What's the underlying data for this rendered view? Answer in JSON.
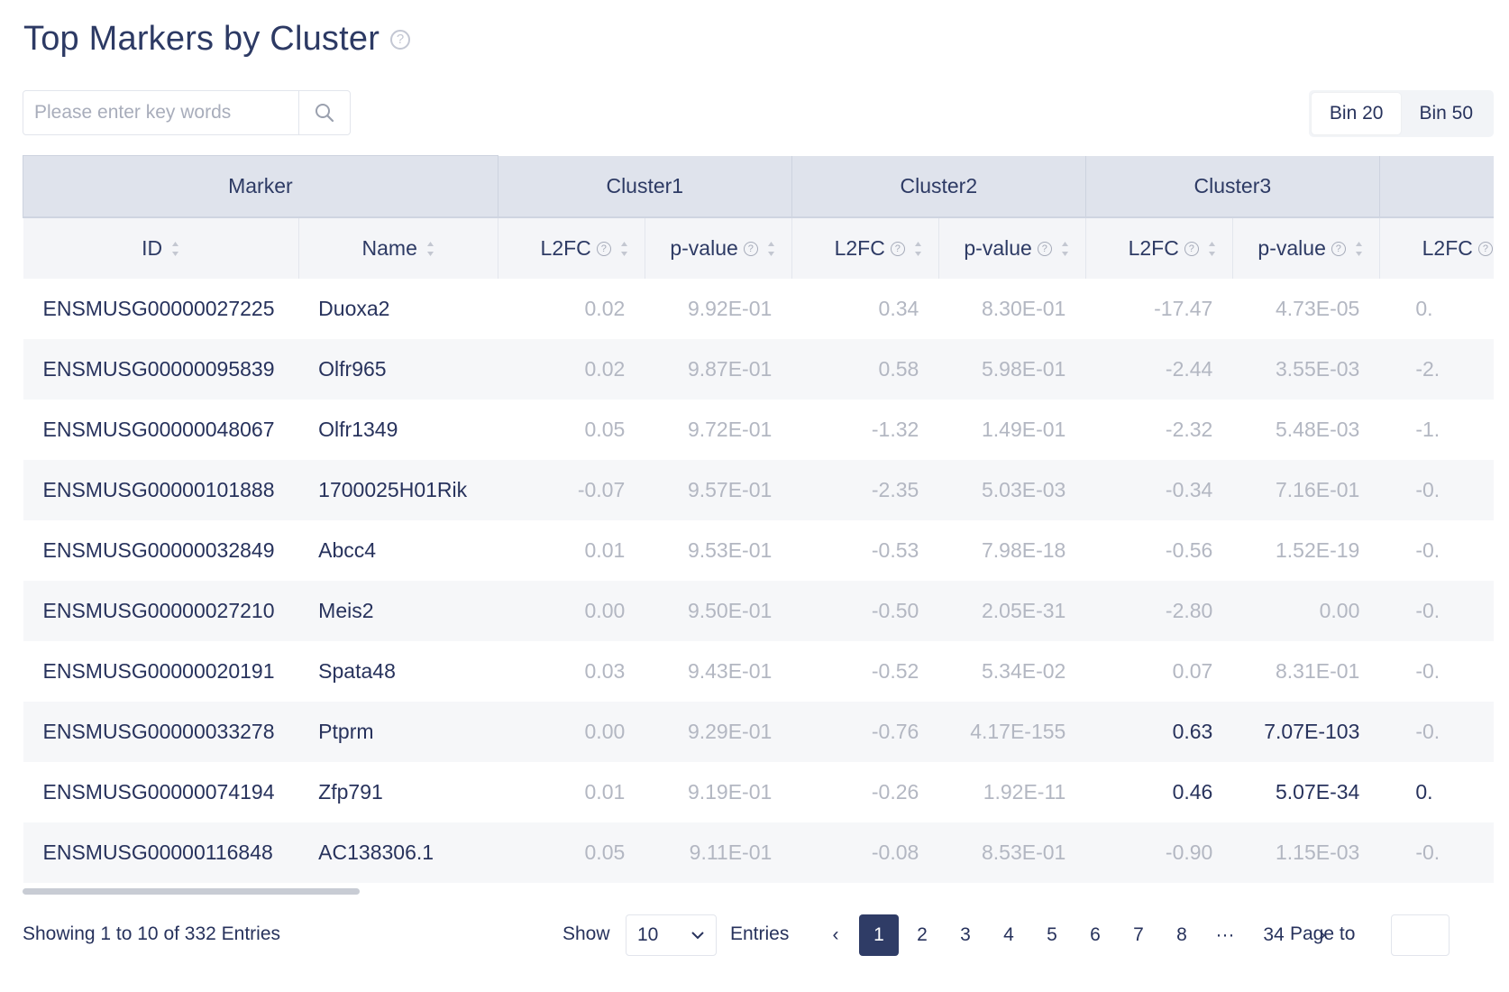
{
  "header": {
    "title": "Top Markers by Cluster",
    "help_glyph": "?"
  },
  "search": {
    "placeholder": "Please enter key words"
  },
  "bins": [
    "Bin 20",
    "Bin 50"
  ],
  "table": {
    "group_headers": {
      "marker": "Marker",
      "clusters": [
        "Cluster1",
        "Cluster2",
        "Cluster3",
        ""
      ]
    },
    "sub_headers": {
      "id": "ID",
      "name": "Name",
      "l2fc": "L2FC",
      "pvalue": "p-value"
    },
    "rows": [
      {
        "id": "ENSMUSG00000027225",
        "name": "Duoxa2",
        "c1_l2fc": "0.02",
        "c1_p": "9.92E-01",
        "c2_l2fc": "0.34",
        "c2_p": "8.30E-01",
        "c3_l2fc": "-17.47",
        "c3_p": "4.73E-05",
        "c4_l2fc": "0."
      },
      {
        "id": "ENSMUSG00000095839",
        "name": "Olfr965",
        "c1_l2fc": "0.02",
        "c1_p": "9.87E-01",
        "c2_l2fc": "0.58",
        "c2_p": "5.98E-01",
        "c3_l2fc": "-2.44",
        "c3_p": "3.55E-03",
        "c4_l2fc": "-2."
      },
      {
        "id": "ENSMUSG00000048067",
        "name": "Olfr1349",
        "c1_l2fc": "0.05",
        "c1_p": "9.72E-01",
        "c2_l2fc": "-1.32",
        "c2_p": "1.49E-01",
        "c3_l2fc": "-2.32",
        "c3_p": "5.48E-03",
        "c4_l2fc": "-1."
      },
      {
        "id": "ENSMUSG00000101888",
        "name": "1700025H01Rik",
        "c1_l2fc": "-0.07",
        "c1_p": "9.57E-01",
        "c2_l2fc": "-2.35",
        "c2_p": "5.03E-03",
        "c3_l2fc": "-0.34",
        "c3_p": "7.16E-01",
        "c4_l2fc": "-0."
      },
      {
        "id": "ENSMUSG00000032849",
        "name": "Abcc4",
        "c1_l2fc": "0.01",
        "c1_p": "9.53E-01",
        "c2_l2fc": "-0.53",
        "c2_p": "7.98E-18",
        "c3_l2fc": "-0.56",
        "c3_p": "1.52E-19",
        "c4_l2fc": "-0."
      },
      {
        "id": "ENSMUSG00000027210",
        "name": "Meis2",
        "c1_l2fc": "0.00",
        "c1_p": "9.50E-01",
        "c2_l2fc": "-0.50",
        "c2_p": "2.05E-31",
        "c3_l2fc": "-2.80",
        "c3_p": "0.00",
        "c4_l2fc": "-0."
      },
      {
        "id": "ENSMUSG00000020191",
        "name": "Spata48",
        "c1_l2fc": "0.03",
        "c1_p": "9.43E-01",
        "c2_l2fc": "-0.52",
        "c2_p": "5.34E-02",
        "c3_l2fc": "0.07",
        "c3_p": "8.31E-01",
        "c4_l2fc": "-0."
      },
      {
        "id": "ENSMUSG00000033278",
        "name": "Ptprm",
        "c1_l2fc": "0.00",
        "c1_p": "9.29E-01",
        "c2_l2fc": "-0.76",
        "c2_p": "4.17E-155",
        "c3_l2fc": "0.63",
        "c3_p": "7.07E-103",
        "c4_l2fc": "-0.",
        "c3_highlight": true
      },
      {
        "id": "ENSMUSG00000074194",
        "name": "Zfp791",
        "c1_l2fc": "0.01",
        "c1_p": "9.19E-01",
        "c2_l2fc": "-0.26",
        "c2_p": "1.92E-11",
        "c3_l2fc": "0.46",
        "c3_p": "5.07E-34",
        "c4_l2fc": "0.",
        "c3_highlight": true,
        "c4_highlight": true
      },
      {
        "id": "ENSMUSG00000116848",
        "name": "AC138306.1",
        "c1_l2fc": "0.05",
        "c1_p": "9.11E-01",
        "c2_l2fc": "-0.08",
        "c2_p": "8.53E-01",
        "c3_l2fc": "-0.90",
        "c3_p": "1.15E-03",
        "c4_l2fc": "-0."
      }
    ]
  },
  "footer": {
    "showing": "Showing 1 to 10 of 332 Entries",
    "show_label": "Show",
    "page_size": "10",
    "entries_label": "Entries",
    "pages": [
      "1",
      "2",
      "3",
      "4",
      "5",
      "6",
      "7",
      "8",
      "···",
      "34"
    ],
    "current_page": "1",
    "prev": "‹",
    "next": "›",
    "page_to_label": "Page to"
  },
  "colors": {
    "header_bg": "#dfe3ec",
    "active_page": "#2f3c66",
    "muted_text": "#b3b7c2",
    "text": "#27325c"
  }
}
